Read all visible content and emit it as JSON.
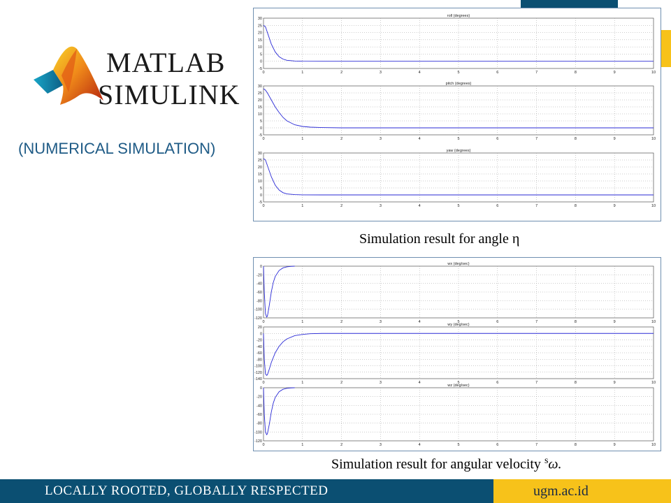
{
  "slide": {
    "logo": {
      "line1": "MATLAB",
      "line2": "SIMULINK"
    },
    "subtitle": "(NUMERICAL SIMULATION)",
    "caption_angle": "Simulation result for angle η",
    "caption_velocity": {
      "text": "Simulation result for angular velocity ",
      "superscript": "s",
      "symbol": "ω."
    },
    "footer": {
      "motto": "LOCALLY ROOTED, GLOBALLY RESPECTED",
      "url": "ugm.ac.id"
    },
    "colors": {
      "navy": "#0b4f72",
      "gold": "#f7c21a",
      "subtitle": "#1f5b86",
      "trace": "#2a2ad6"
    }
  },
  "chart_data": [
    {
      "type": "line",
      "title": "roll (degrees)",
      "xlim": [
        0,
        10
      ],
      "ylim": [
        -5,
        30
      ],
      "xticks": [
        "0",
        "1",
        "2",
        "3",
        "4",
        "5",
        "6",
        "7",
        "8",
        "9",
        "10"
      ],
      "yticks": [
        "30",
        "25",
        "20",
        "15",
        "10",
        "5",
        "0",
        "-5"
      ],
      "xtick_values": [
        0,
        1,
        2,
        3,
        4,
        5,
        6,
        7,
        8,
        9,
        10
      ],
      "ytick_values": [
        30,
        25,
        20,
        15,
        10,
        5,
        0,
        -5
      ],
      "grid": true,
      "x": [
        0,
        0.05,
        0.1,
        0.2,
        0.3,
        0.4,
        0.5,
        0.6,
        0.8,
        1.0,
        1.5,
        2,
        10
      ],
      "y": [
        25,
        24,
        20,
        12,
        6.5,
        3.2,
        1.5,
        0.7,
        0.2,
        0.05,
        0,
        0,
        0
      ]
    },
    {
      "type": "line",
      "title": "pitch (degrees)",
      "xlim": [
        0,
        10
      ],
      "ylim": [
        -5,
        30
      ],
      "xticks": [
        "0",
        "1",
        "2",
        "3",
        "4",
        "5",
        "6",
        "7",
        "8",
        "9",
        "10"
      ],
      "yticks": [
        "30",
        "25",
        "20",
        "15",
        "10",
        "5",
        "0",
        "-5"
      ],
      "xtick_values": [
        0,
        1,
        2,
        3,
        4,
        5,
        6,
        7,
        8,
        9,
        10
      ],
      "ytick_values": [
        30,
        25,
        20,
        15,
        10,
        5,
        0,
        -5
      ],
      "grid": true,
      "x": [
        0,
        0.05,
        0.1,
        0.2,
        0.3,
        0.4,
        0.5,
        0.6,
        0.8,
        1.0,
        1.2,
        1.5,
        2,
        10
      ],
      "y": [
        28,
        27,
        25,
        20,
        15,
        11,
        7.5,
        5,
        2.2,
        1,
        0.5,
        0.2,
        0,
        0
      ]
    },
    {
      "type": "line",
      "title": "yaw (degrees)",
      "xlim": [
        0,
        10
      ],
      "ylim": [
        -5,
        30
      ],
      "xticks": [
        "0",
        "1",
        "2",
        "3",
        "4",
        "5",
        "6",
        "7",
        "8",
        "9",
        "10"
      ],
      "yticks": [
        "30",
        "25",
        "20",
        "15",
        "10",
        "5",
        "0",
        "-5"
      ],
      "xtick_values": [
        0,
        1,
        2,
        3,
        4,
        5,
        6,
        7,
        8,
        9,
        10
      ],
      "ytick_values": [
        30,
        25,
        20,
        15,
        10,
        5,
        0,
        -5
      ],
      "grid": true,
      "x": [
        0,
        0.05,
        0.1,
        0.2,
        0.3,
        0.4,
        0.5,
        0.6,
        0.8,
        1.0,
        1.5,
        2,
        10
      ],
      "y": [
        26,
        25,
        21,
        13,
        7,
        3.5,
        1.6,
        0.7,
        0.2,
        0.05,
        0,
        0,
        0
      ]
    },
    {
      "type": "line",
      "title": "wx (deg/sec)",
      "xlim": [
        0,
        10
      ],
      "ylim": [
        -120,
        0
      ],
      "xticks": [
        "0",
        "1",
        "2",
        "3",
        "4",
        "5",
        "6",
        "7",
        "8",
        "9",
        "10"
      ],
      "yticks": [
        "0",
        "-20",
        "-40",
        "-60",
        "-80",
        "-100",
        "-120"
      ],
      "xtick_values": [
        0,
        1,
        2,
        3,
        4,
        5,
        6,
        7,
        8,
        9,
        10
      ],
      "ytick_values": [
        0,
        -20,
        -40,
        -60,
        -80,
        -100,
        -120
      ],
      "grid": true,
      "x": [
        0,
        0.02,
        0.05,
        0.08,
        0.1,
        0.15,
        0.2,
        0.25,
        0.3,
        0.4,
        0.5,
        0.6,
        0.7,
        0.8
      ],
      "y": [
        0,
        -60,
        -110,
        -118,
        -116,
        -90,
        -60,
        -38,
        -24,
        -10,
        -4,
        -1.5,
        -0.5,
        0
      ]
    },
    {
      "type": "line",
      "title": "wy (deg/sec)",
      "xlim": [
        0,
        10
      ],
      "ylim": [
        -140,
        20
      ],
      "xticks": [
        "0",
        "1",
        "2",
        "3",
        "4",
        "5",
        "6",
        "7",
        "8",
        "9",
        "10"
      ],
      "yticks": [
        "20",
        "0",
        "-20",
        "-40",
        "-60",
        "-80",
        "-100",
        "-120",
        "-140"
      ],
      "xtick_values": [
        0,
        1,
        2,
        3,
        4,
        5,
        6,
        7,
        8,
        9,
        10
      ],
      "ytick_values": [
        20,
        0,
        -20,
        -40,
        -60,
        -80,
        -100,
        -120,
        -140
      ],
      "grid": true,
      "x": [
        0,
        0.02,
        0.05,
        0.08,
        0.1,
        0.15,
        0.2,
        0.3,
        0.4,
        0.5,
        0.6,
        0.8,
        1.0,
        1.2,
        1.5,
        10
      ],
      "y": [
        0,
        -80,
        -125,
        -130,
        -128,
        -110,
        -90,
        -60,
        -40,
        -26,
        -17,
        -7,
        -3,
        -1,
        0,
        0
      ]
    },
    {
      "type": "line",
      "title": "wz (deg/sec)",
      "xlim": [
        0,
        10
      ],
      "ylim": [
        -120,
        0
      ],
      "xticks": [
        "0",
        "1",
        "2",
        "3",
        "4",
        "5",
        "6",
        "7",
        "8",
        "9",
        "10"
      ],
      "yticks": [
        "0",
        "-20",
        "-40",
        "-60",
        "-80",
        "-100",
        "-120"
      ],
      "xtick_values": [
        0,
        1,
        2,
        3,
        4,
        5,
        6,
        7,
        8,
        9,
        10
      ],
      "ytick_values": [
        0,
        -20,
        -40,
        -60,
        -80,
        -100,
        -120
      ],
      "grid": true,
      "x": [
        0,
        0.02,
        0.05,
        0.08,
        0.1,
        0.15,
        0.2,
        0.25,
        0.3,
        0.4,
        0.5,
        0.6,
        0.7,
        0.8
      ],
      "y": [
        0,
        -60,
        -100,
        -106,
        -104,
        -82,
        -55,
        -35,
        -22,
        -9,
        -3.5,
        -1.2,
        -0.4,
        0
      ]
    }
  ]
}
